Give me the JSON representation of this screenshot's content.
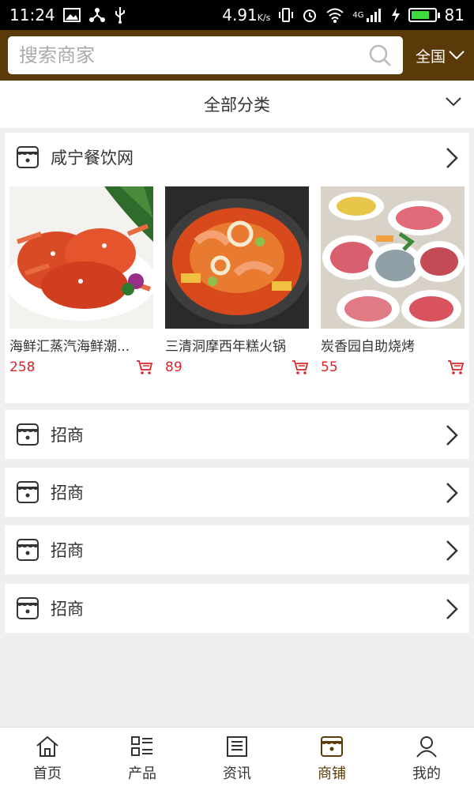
{
  "status": {
    "time": "11:24",
    "speed": "4.91",
    "speed_unit": "K/s",
    "network": "4G",
    "battery": "81",
    "battery_level_pct": 81,
    "icons": [
      "image-icon",
      "share-icon",
      "usb-icon",
      "vibrate-icon",
      "alarm-icon",
      "wifi-icon",
      "signal-icon",
      "charging-icon"
    ]
  },
  "search": {
    "placeholder": "搜索商家"
  },
  "region": {
    "label": "全国"
  },
  "category": {
    "label": "全部分类"
  },
  "store": {
    "name": "咸宁餐饮网",
    "products": [
      {
        "name": "海鲜汇蒸汽海鲜潮...",
        "price": "258"
      },
      {
        "name": "三清洞摩西年糕火锅",
        "price": "89"
      },
      {
        "name": "炭香园自助烧烤",
        "price": "55"
      }
    ]
  },
  "merchants": [
    {
      "name": "招商"
    },
    {
      "name": "招商"
    },
    {
      "name": "招商"
    },
    {
      "name": "招商"
    }
  ],
  "nav": {
    "items": [
      {
        "label": "首页",
        "icon": "home-icon"
      },
      {
        "label": "产品",
        "icon": "grid-icon"
      },
      {
        "label": "资讯",
        "icon": "news-icon"
      },
      {
        "label": "商铺",
        "icon": "store-icon",
        "active": true
      },
      {
        "label": "我的",
        "icon": "user-icon"
      }
    ]
  },
  "colors": {
    "brand": "#5a3a08",
    "price": "#d9262b",
    "battery": "#3ddc3d"
  }
}
